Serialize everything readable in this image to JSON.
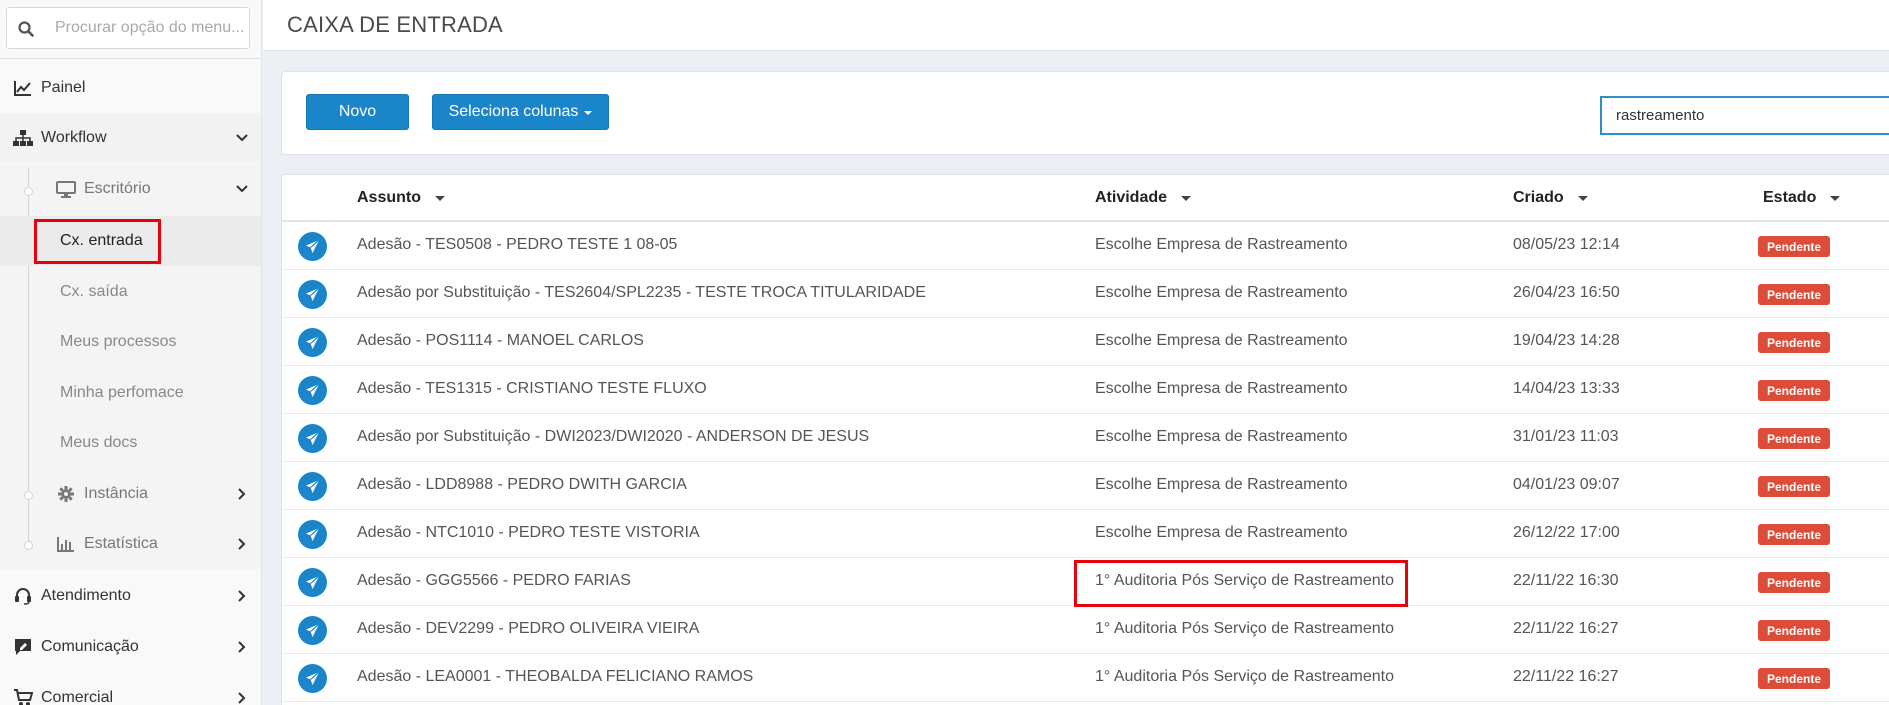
{
  "sidebar": {
    "search_placeholder": "Procurar opção do menu...",
    "painel": "Painel",
    "workflow": "Workflow",
    "escritorio": "Escritório",
    "leaves": [
      "Cx. entrada",
      "Cx. saída",
      "Meus processos",
      "Minha perfomace",
      "Meus docs"
    ],
    "instancia": "Instância",
    "estatistica": "Estatística",
    "atendimento": "Atendimento",
    "comunicacao": "Comunicação",
    "comercial": "Comercial"
  },
  "page": {
    "title": "CAIXA DE ENTRADA"
  },
  "toolbar": {
    "novo_label": "Novo",
    "columns_label": "Seleciona colunas",
    "filter_value": "rastreamento"
  },
  "table": {
    "headers": {
      "assunto": "Assunto",
      "atividade": "Atividade",
      "criado": "Criado",
      "estado": "Estado"
    },
    "rows": [
      {
        "assunto": "Adesão - TES0508 - PEDRO TESTE 1 08-05",
        "atividade": "Escolhe Empresa de Rastreamento",
        "criado": "08/05/23 12:14",
        "estado": "Pendente"
      },
      {
        "assunto": "Adesão por Substituição - TES2604/SPL2235 - TESTE TROCA TITULARIDADE",
        "atividade": "Escolhe Empresa de Rastreamento",
        "criado": "26/04/23 16:50",
        "estado": "Pendente"
      },
      {
        "assunto": "Adesão - POS1114 - MANOEL CARLOS",
        "atividade": "Escolhe Empresa de Rastreamento",
        "criado": "19/04/23 14:28",
        "estado": "Pendente"
      },
      {
        "assunto": "Adesão - TES1315 - CRISTIANO TESTE FLUXO",
        "atividade": "Escolhe Empresa de Rastreamento",
        "criado": "14/04/23 13:33",
        "estado": "Pendente"
      },
      {
        "assunto": "Adesão por Substituição - DWI2023/DWI2020 - ANDERSON DE JESUS",
        "atividade": "Escolhe Empresa de Rastreamento",
        "criado": "31/01/23 11:03",
        "estado": "Pendente"
      },
      {
        "assunto": "Adesão - LDD8988 - PEDRO DWITH GARCIA",
        "atividade": "Escolhe Empresa de Rastreamento",
        "criado": "04/01/23 09:07",
        "estado": "Pendente"
      },
      {
        "assunto": "Adesão - NTC1010 - PEDRO TESTE VISTORIA",
        "atividade": "Escolhe Empresa de Rastreamento",
        "criado": "26/12/22 17:00",
        "estado": "Pendente"
      },
      {
        "assunto": "Adesão - GGG5566 - PEDRO FARIAS",
        "atividade": "1° Auditoria Pós Serviço de Rastreamento",
        "criado": "22/11/22 16:30",
        "estado": "Pendente"
      },
      {
        "assunto": "Adesão - DEV2299 - PEDRO OLIVEIRA VIEIRA",
        "atividade": "1° Auditoria Pós Serviço de Rastreamento",
        "criado": "22/11/22 16:27",
        "estado": "Pendente"
      },
      {
        "assunto": "Adesão - LEA0001 - THEOBALDA FELICIANO RAMOS",
        "atividade": "1° Auditoria Pós Serviço de Rastreamento",
        "criado": "22/11/22 16:27",
        "estado": "Pendente"
      }
    ]
  },
  "colors": {
    "primary": "#1a85c9",
    "danger_badge": "#dd4b39",
    "highlight": "#e8000b"
  }
}
